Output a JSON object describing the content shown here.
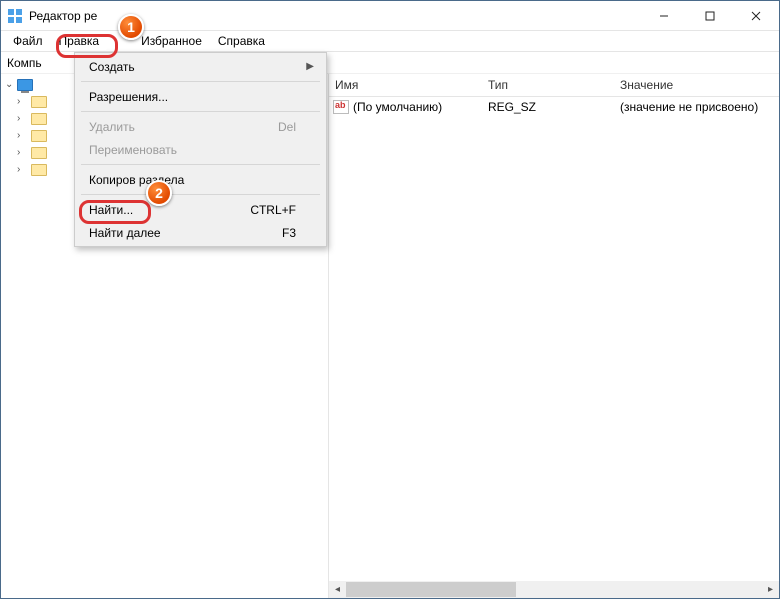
{
  "window": {
    "title": "Редактор ре"
  },
  "menubar": {
    "file": "Файл",
    "edit": "Правка",
    "favorites": "Избранное",
    "help": "Справка"
  },
  "addressbar": {
    "path": "Компь"
  },
  "tree": {
    "root": "",
    "children": [
      "",
      "",
      "",
      "",
      ""
    ]
  },
  "columns": {
    "name": "Имя",
    "type": "Тип",
    "value": "Значение"
  },
  "rows": [
    {
      "name": "(По умолчанию)",
      "type": "REG_SZ",
      "value": "(значение не присвоено)"
    }
  ],
  "dropdown": {
    "create": "Создать",
    "permissions": "Разрешения...",
    "delete": "Удалить",
    "delete_sc": "Del",
    "rename": "Переименовать",
    "copykey": "Копиров             раздела",
    "find": "Найти...",
    "find_sc": "CTRL+F",
    "findnext": "Найти далее",
    "findnext_sc": "F3"
  },
  "badges": {
    "one": "1",
    "two": "2"
  }
}
